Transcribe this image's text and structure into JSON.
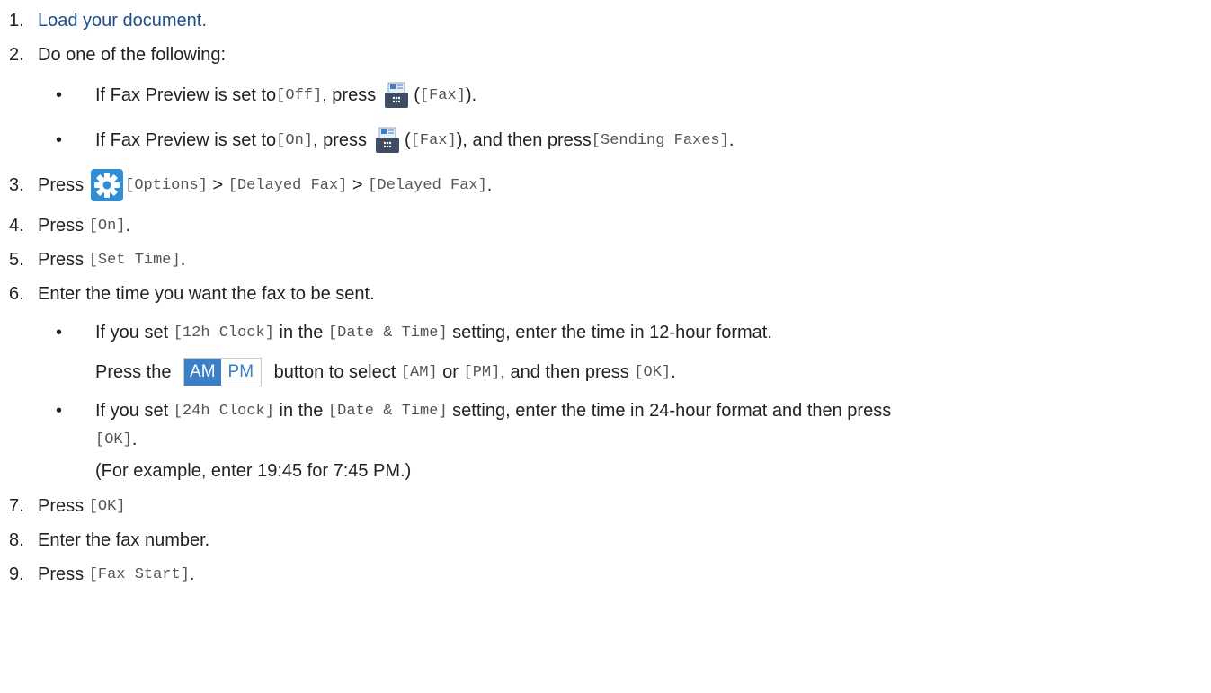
{
  "steps": {
    "s1": {
      "num": "1.",
      "text": "Load your document."
    },
    "s2": {
      "num": "2.",
      "text": "Do one of the following:"
    },
    "s2a": {
      "bullet": "•",
      "t1": "If Fax Preview is set to ",
      "m1": "[Off]",
      "t2": ", press ",
      "t3": " (",
      "m2": "[Fax]",
      "t4": ")."
    },
    "s2b": {
      "bullet": "•",
      "t1": "If Fax Preview is set to ",
      "m1": "[On]",
      "t2": ", press ",
      "t3": " (",
      "m2": "[Fax]",
      "t4": "), and then press ",
      "m3": "[Sending Faxes]",
      "t5": "."
    },
    "s3": {
      "num": "3.",
      "t1": "Press ",
      "m1": "[Options]",
      "t2": " > ",
      "m2": "[Delayed Fax]",
      "t3": " > ",
      "m3": "[Delayed Fax]",
      "t4": "."
    },
    "s4": {
      "num": "4.",
      "t1": "Press ",
      "m1": "[On]",
      "t2": "."
    },
    "s5": {
      "num": "5.",
      "t1": "Press ",
      "m1": "[Set Time]",
      "t2": "."
    },
    "s6": {
      "num": "6.",
      "text": "Enter the time you want the fax to be sent."
    },
    "s6a": {
      "bullet": "•",
      "t1": "If you set ",
      "m1": "[12h Clock]",
      "t2": " in the ",
      "m2": "[Date & Time]",
      "t3": " setting, enter the time in 12-hour format."
    },
    "s6a2": {
      "t1": "Press the ",
      "am": "AM",
      "pm": "PM",
      "t2": " button to select ",
      "m1": "[AM]",
      "t3": " or ",
      "m2": "[PM]",
      "t4": ", and then press ",
      "m3": "[OK]",
      "t5": "."
    },
    "s6b": {
      "bullet": "•",
      "t1": "If you set ",
      "m1": "[24h Clock]",
      "t2": " in the ",
      "m2": "[Date & Time]",
      "t3": " setting, enter the time in 24-hour format and then press"
    },
    "s6b2": {
      "m1": "[OK]",
      "t1": "."
    },
    "s6b3": {
      "text": "(For example, enter 19:45 for 7:45 PM.)"
    },
    "s7": {
      "num": "7.",
      "t1": "Press ",
      "m1": "[OK]"
    },
    "s8": {
      "num": "8.",
      "text": "Enter the fax number."
    },
    "s9": {
      "num": "9.",
      "t1": "Press ",
      "m1": "[Fax Start]",
      "t2": "."
    }
  },
  "colors": {
    "link": "#1f4f8c",
    "accent": "#2f8ed6"
  },
  "icons": {
    "fax": "fax-icon",
    "options": "gear-icon"
  }
}
